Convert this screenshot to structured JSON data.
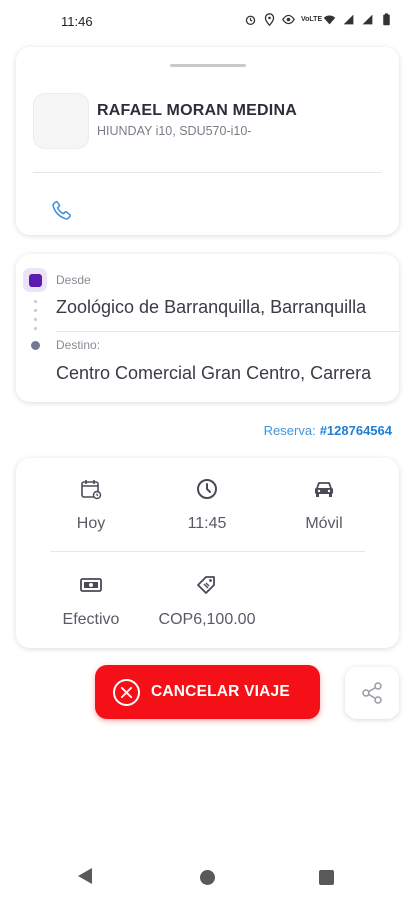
{
  "status_bar": {
    "time": "11:46",
    "icons": [
      "alarm-icon",
      "location-icon",
      "eye-icon",
      "volte-icon",
      "wifi-icon",
      "signal-icon",
      "signal-icon",
      "battery-icon"
    ],
    "volte_text": "VoLTE"
  },
  "driver": {
    "name": "RAFAEL MORAN MEDINA",
    "vehicle": "HIUNDAY i10, SDU570-i10-",
    "call_icon": "phone-icon"
  },
  "route": {
    "from_label": "Desde",
    "from_value": "Zoológico de Barranquilla, Barranquilla",
    "to_label": "Destino:",
    "to_value": "Centro Comercial Gran Centro, Carrera"
  },
  "reservation": {
    "label": "Reserva:",
    "number": "#128764564"
  },
  "details": {
    "date_icon": "calendar-icon",
    "date": "Hoy",
    "time_icon": "clock-icon",
    "time": "11:45",
    "vehicle_icon": "car-icon",
    "vehicle_type": "Móvil",
    "payment_icon": "cash-icon",
    "payment_method": "Efectivo",
    "price_icon": "price-tag-icon",
    "price": "COP6,100.00"
  },
  "actions": {
    "cancel_label": "CANCELAR VIAJE",
    "share_icon": "share-icon"
  },
  "colors": {
    "accent_purple": "#5e1bb0",
    "cancel_red": "#f50f17",
    "link_blue": "#1f7fd3"
  }
}
